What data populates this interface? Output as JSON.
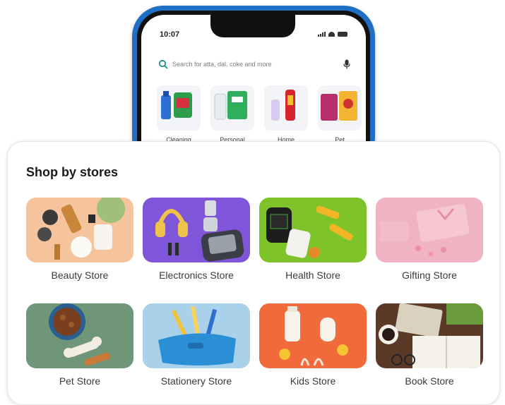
{
  "phone": {
    "time": "10:07",
    "search_placeholder": "Search for atta, dal, coke and more",
    "categories": [
      {
        "label": "Cleaning"
      },
      {
        "label": "Personal"
      },
      {
        "label": "Home"
      },
      {
        "label": "Pet"
      }
    ]
  },
  "section": {
    "title": "Shop by stores",
    "stores": [
      {
        "label": "Beauty Store"
      },
      {
        "label": "Electronics Store"
      },
      {
        "label": "Health Store"
      },
      {
        "label": "Gifting Store"
      },
      {
        "label": "Pet Store"
      },
      {
        "label": "Stationery Store"
      },
      {
        "label": "Kids Store"
      },
      {
        "label": "Book Store"
      }
    ]
  },
  "colors": {
    "phone_frame": "#1f6fc4",
    "search_accent": "#1a8f8a"
  }
}
